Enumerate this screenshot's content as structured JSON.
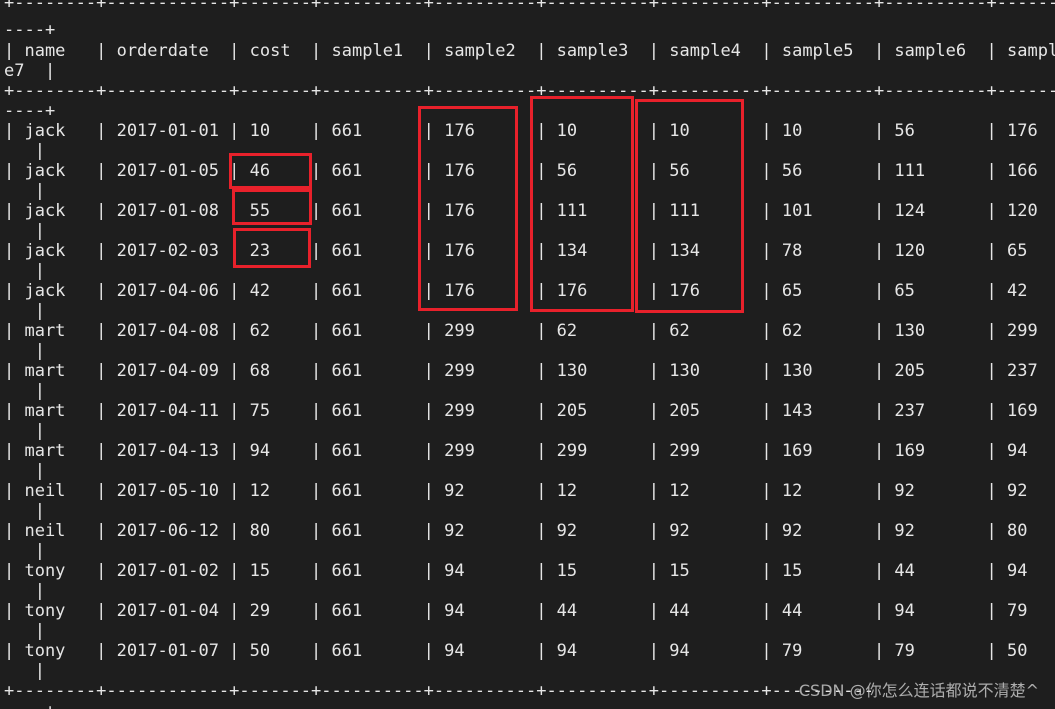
{
  "terminal": {
    "top_border": "+--------+------------+-------+----------+----------+----------+----------+----------+----------+-----------",
    "top_border_cont": "----+",
    "header_line": "| name   | orderdate  | cost  | sample1  | sample2  | sample3  | sample4  | sample5  | sample6  | sampl",
    "header_cont": "e7  |",
    "mid_border": "+--------+------------+-------+----------+----------+----------+----------+----------+----------+-----------",
    "mid_border_cont": "----+",
    "rows": [
      {
        "line": "| jack   | 2017-01-01 | 10    | 661      | 176      | 10       | 10       | 10       | 56       | 176",
        "cont": "   |"
      },
      {
        "line": "| jack   | 2017-01-05 | 46    | 661      | 176      | 56       | 56       | 56       | 111      | 166",
        "cont": "   |"
      },
      {
        "line": "| jack   | 2017-01-08 | 55    | 661      | 176      | 111      | 111      | 101      | 124      | 120",
        "cont": "   |"
      },
      {
        "line": "| jack   | 2017-02-03 | 23    | 661      | 176      | 134      | 134      | 78       | 120      | 65",
        "cont": "   |"
      },
      {
        "line": "| jack   | 2017-04-06 | 42    | 661      | 176      | 176      | 176      | 65       | 65       | 42",
        "cont": "   |"
      },
      {
        "line": "| mart   | 2017-04-08 | 62    | 661      | 299      | 62       | 62       | 62       | 130      | 299",
        "cont": "   |"
      },
      {
        "line": "| mart   | 2017-04-09 | 68    | 661      | 299      | 130      | 130      | 130      | 205      | 237",
        "cont": "   |"
      },
      {
        "line": "| mart   | 2017-04-11 | 75    | 661      | 299      | 205      | 205      | 143      | 237      | 169",
        "cont": "   |"
      },
      {
        "line": "| mart   | 2017-04-13 | 94    | 661      | 299      | 299      | 299      | 169      | 169      | 94",
        "cont": "   |"
      },
      {
        "line": "| neil   | 2017-05-10 | 12    | 661      | 92       | 12       | 12       | 12       | 92       | 92",
        "cont": "   |"
      },
      {
        "line": "| neil   | 2017-06-12 | 80    | 661      | 92       | 92       | 92       | 92       | 92       | 80",
        "cont": "   |"
      },
      {
        "line": "| tony   | 2017-01-02 | 15    | 661      | 94       | 15       | 15       | 15       | 44       | 94",
        "cont": "   |"
      },
      {
        "line": "| tony   | 2017-01-04 | 29    | 661      | 94       | 44       | 44       | 44       | 94       | 79",
        "cont": "   |"
      },
      {
        "line": "| tony   | 2017-01-07 | 50    | 661      | 94       | 94       | 94       | 79       | 79       | 50",
        "cont": "   |"
      }
    ],
    "bottom_border": "+--------+------------+-------+----------+----------+----------+----------+----------",
    "bottom_border_cont": "----+"
  },
  "watermark": "CSDN @你怎么连话都说不清楚^",
  "colors": {
    "background": "#1e1e1e",
    "text": "#e6e6e6",
    "highlight": "#e8212b"
  }
}
